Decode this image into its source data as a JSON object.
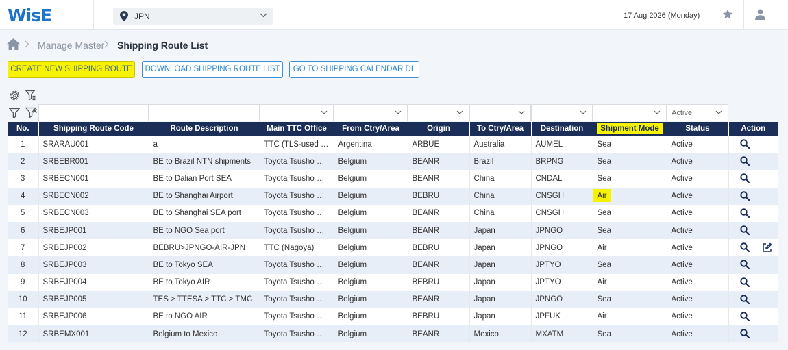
{
  "header": {
    "logo_main": "WisE",
    "country_value": "JPN",
    "date": "17 Aug 2026 (Monday)"
  },
  "breadcrumb": {
    "level1": "Manage Master",
    "current": "Shipping Route List"
  },
  "actions": {
    "create_label": "CREATE NEW SHIPPING ROUTE",
    "download_label": "DOWNLOAD SHIPPING ROUTE LIST",
    "calendar_label": "GO TO SHIPPING CALENDAR DL"
  },
  "filters": {
    "status_value": "Active"
  },
  "table": {
    "columns": [
      "No.",
      "Shipping Route Code",
      "Route Description",
      "Main TTC Office",
      "From Ctry/Area",
      "Origin",
      "To Ctry/Area",
      "Destination",
      "Shipment Mode",
      "Status",
      "Action"
    ],
    "rows": [
      [
        "1",
        "SRARAU001",
        "a",
        "TTC (TLS-used o...",
        "Argentina",
        "ARBUE",
        "Australia",
        "AUMEL",
        "Sea",
        "Active"
      ],
      [
        "2",
        "SRBEBR001",
        "BE to Brazil NTN shipments",
        "Toyota Tsusho Eu...",
        "Belgium",
        "BEANR",
        "Brazil",
        "BRPNG",
        "Sea",
        "Active"
      ],
      [
        "3",
        "SRBECN001",
        "BE to Dalian Port SEA",
        "Toyota Tsusho Eu...",
        "Belgium",
        "BEANR",
        "China",
        "CNDAL",
        "Sea",
        "Active"
      ],
      [
        "4",
        "SRBECN002",
        "BE to Shanghai Airport",
        "Toyota Tsusho Eu...",
        "Belgium",
        "BEBRU",
        "China",
        "CNSGH",
        "Air",
        "Active"
      ],
      [
        "5",
        "SRBECN003",
        "BE to Shanghai SEA port",
        "Toyota Tsusho Eu...",
        "Belgium",
        "BEANR",
        "China",
        "CNSGH",
        "Sea",
        "Active"
      ],
      [
        "6",
        "SRBEJP001",
        "BE to NGO Sea port",
        "Toyota Tsusho Eu...",
        "Belgium",
        "BEANR",
        "Japan",
        "JPNGO",
        "Sea",
        "Active"
      ],
      [
        "7",
        "SRBEJP002",
        "BEBRU>JPNGO-AIR-JPN",
        "TTC (Nagoya)",
        "Belgium",
        "BEBRU",
        "Japan",
        "JPNGO",
        "Air",
        "Active"
      ],
      [
        "8",
        "SRBEJP003",
        "BE to Tokyo SEA",
        "Toyota Tsusho Eu...",
        "Belgium",
        "BEANR",
        "Japan",
        "JPTYO",
        "Sea",
        "Active"
      ],
      [
        "9",
        "SRBEJP004",
        "BE to Tokyo AIR",
        "Toyota Tsusho Eu...",
        "Belgium",
        "BEBRU",
        "Japan",
        "JPTYO",
        "Air",
        "Active"
      ],
      [
        "10",
        "SRBEJP005",
        "TES > TTESA > TTC > TMC",
        "Toyota Tsusho Eu...",
        "Belgium",
        "BEANR",
        "Japan",
        "JPNGO",
        "Sea",
        "Active"
      ],
      [
        "11",
        "SRBEJP006",
        "BE to NGO AIR",
        "Toyota Tsusho Eu...",
        "Belgium",
        "BEBRU",
        "Japan",
        "JPFUK",
        "Air",
        "Active"
      ],
      [
        "12",
        "SRBEMX001",
        "Belgium to Mexico",
        "Toyota Tsusho Eu...",
        "Belgium",
        "BEANR",
        "Mexico",
        "MXATM",
        "Sea",
        "Active"
      ]
    ]
  },
  "colors": {
    "primary": "#1e74c9",
    "header_bg": "#1a2e58",
    "highlight": "#f7f300",
    "row_alt": "#e8eef8"
  }
}
